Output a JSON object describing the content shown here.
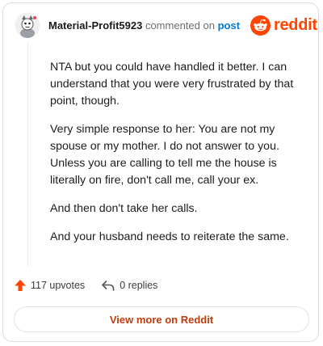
{
  "comment": {
    "username": "Material-Profit5923",
    "commented_text": "commented on",
    "post_link": "post",
    "paragraphs": [
      "NTA but you could have handled it better. I can understand that you were very frustrated by that point, though.",
      "Very simple response to her: You are not my spouse or my mother. I do not answer to you. Unless you are calling to tell me the house is literally on fire, don't call me, call your ex.",
      "And then don't take her calls.",
      "And your husband needs to reiterate the same."
    ]
  },
  "brand": {
    "logo_text": "reddit",
    "color": "#ff4500"
  },
  "actions": {
    "upvotes_label": "117 upvotes",
    "replies_label": "0 replies"
  },
  "footer": {
    "view_button_label": "View more on Reddit"
  },
  "icons": {
    "avatar": "avatar-icon",
    "logo": "reddit-logo-icon",
    "upvote": "upvote-arrow-icon",
    "reply": "reply-arrow-icon"
  }
}
